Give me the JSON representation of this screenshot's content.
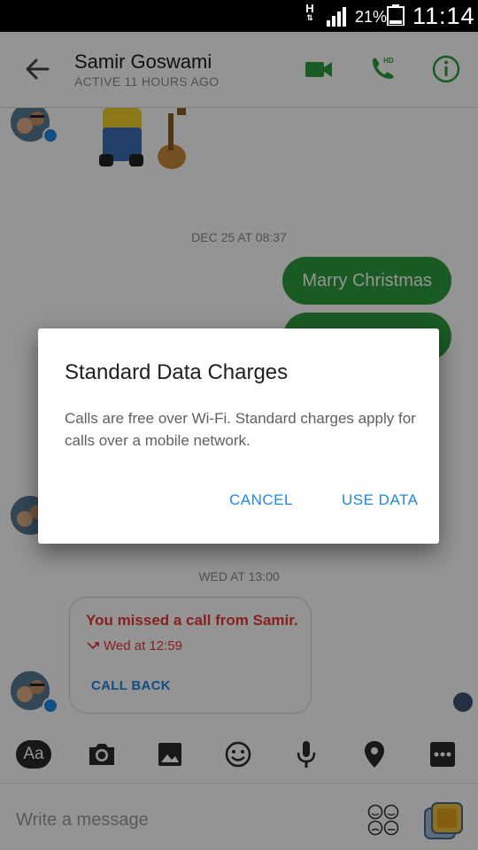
{
  "status_bar": {
    "network_type": "H",
    "battery_percent": "21%",
    "time": "11:14"
  },
  "header": {
    "contact_name": "Samir Goswami",
    "contact_status": "ACTIVE 11 HOURS AGO",
    "icons": [
      "back-arrow-icon",
      "video-camera-icon",
      "phone-hd-icon",
      "info-icon"
    ],
    "accent_color": "#2e9e3e"
  },
  "conversation": {
    "date_separator_1": "DEC 25 AT 08:37",
    "outgoing_messages": [
      "Marry Christmas",
      ""
    ],
    "date_separator_2": "WED AT 13:00",
    "missed_call": {
      "title": "You missed a call from Samir.",
      "time": "Wed at 12:59",
      "action": "CALL BACK"
    }
  },
  "toolbar": {
    "aa_label": "Aa",
    "icons": [
      "camera-icon",
      "gallery-icon",
      "emoji-icon",
      "microphone-icon",
      "location-icon",
      "more-icon"
    ]
  },
  "composer": {
    "placeholder": "Write a message"
  },
  "dialog": {
    "title": "Standard Data Charges",
    "body": "Calls are free over Wi-Fi. Standard charges apply for calls over a mobile network.",
    "cancel_label": "CANCEL",
    "confirm_label": "USE DATA"
  }
}
